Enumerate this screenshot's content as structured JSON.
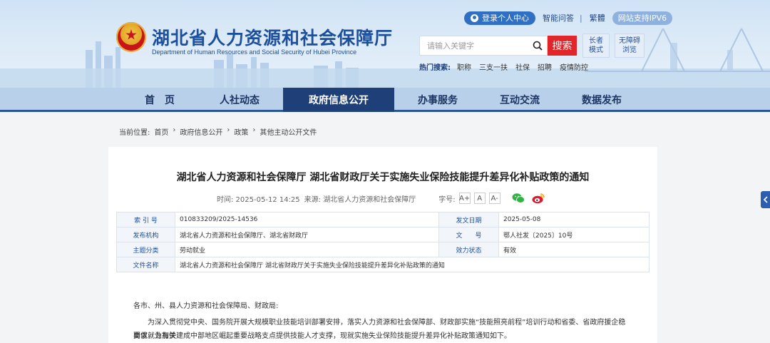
{
  "header": {
    "logo_cn": "湖北省人力资源和社会保障厅",
    "logo_en": "Department of Human Resources and Social Security of Hubei Province",
    "login_label": "登录个人中心",
    "smart_qa": "智能问答",
    "traditional": "繁體",
    "ipv6": "网站支持IPV6",
    "search_placeholder": "请输入关键字",
    "search_button": "搜索",
    "elder_mode": [
      "长者",
      "模式"
    ],
    "accessible": [
      "无障碍",
      "浏览"
    ],
    "hot_label": "热门搜索:",
    "hot_items": [
      "职称",
      "三支一扶",
      "社保",
      "招聘",
      "疫情防控"
    ]
  },
  "nav": {
    "items": [
      {
        "label": "首　页"
      },
      {
        "label": "人社动态"
      },
      {
        "label": "政府信息公开"
      },
      {
        "label": "办事服务"
      },
      {
        "label": "互动交流"
      },
      {
        "label": "数据发布"
      }
    ],
    "active_index": 2
  },
  "breadcrumb": {
    "items": [
      "当前位置:",
      "首页",
      "›",
      "政府信息公开",
      "›",
      "政策",
      "›",
      "其他主动公开文件"
    ]
  },
  "article": {
    "title": "湖北省人力资源和社会保障厅 湖北省财政厅关于实施失业保险技能提升差异化补贴政策的通知",
    "time": "时间: 2025-05-12 14:25",
    "source": "来源: 湖北省人力资源和社会保障厅",
    "font_label": "字号:",
    "font_sizes": [
      "A+",
      "A",
      "A-"
    ],
    "info": {
      "index_no_label": "索 引 号",
      "index_no": "010833209/2025-14536",
      "publish_date_label": "发文日期",
      "publish_date": "2025-05-08",
      "issuer_label": "发布机构",
      "issuer": "湖北省人力资源和社会保障厅、湖北省财政厅",
      "doc_no_label": "文　　号",
      "doc_no": "鄂人社发〔2025〕10号",
      "category_label": "主题分类",
      "category": "劳动就业",
      "status_label": "效力状态",
      "status": "有效",
      "filename_label": "文件名称",
      "filename": "湖北省人力资源和社会保障厅 湖北省财政厅关于实施失业保险技能提升差异化补贴政策的通知"
    },
    "body": [
      "各市、州、县人力资源和社会保障局、财政局:",
      "为深入贯彻党中央、国务院开展大规模职业技能培训部署安排，落实人力资源和社会保障部、财政部实施“技能照亮前程”培训行动和省委、省政府援企稳岗促就业有关",
      "要求，为加快建成中部地区崛起重要战略支点提供技能人才支撑，现就实施失业保险技能提升差异化补贴政策通知如下。"
    ]
  },
  "colors": {
    "primary": "#1f3f78",
    "accent_red": "#e0262b",
    "link_blue": "#1c4f9c"
  }
}
